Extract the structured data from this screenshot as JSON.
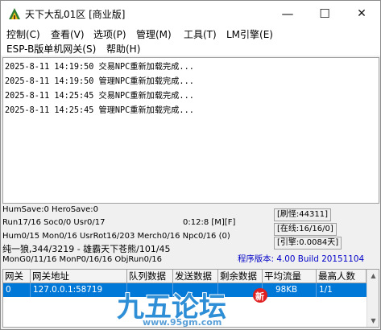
{
  "window": {
    "title": "天下大乱01区 [商业版]"
  },
  "menus": [
    "控制(C)",
    "查看(V)",
    "选项(P)",
    "管理(M)",
    "工具(T)",
    "LM引擎(E)",
    "ESP-B版单机网关(S)",
    "帮助(H)"
  ],
  "log": [
    "2025-8-11 14:19:50 交易NPC重新加载完成...",
    "2025-8-11 14:19:50 管理NPC重新加载完成...",
    "2025-8-11 14:25:45 交易NPC重新加载完成...",
    "2025-8-11 14:25:45 管理NPC重新加载完成..."
  ],
  "status": {
    "line1": "HumSave:0 HeroSave:0",
    "line2": "Run17/16 Soc0/0 Usr0/17",
    "line3": "Hum0/15 Mon0/16 UsrRot16/203 Merch0/16 Npc0/16 (0)",
    "line4": "纯一狼,344/3219 - 雄霸天下苍熊/101/45",
    "line5": "MonG0/11/16 MonP0/16/16 ObjRun0/16",
    "timer": "0:12:8 [M][F]",
    "refresh": "[刷怪:44311]",
    "online": "[在线:16/16/0]",
    "engine": "[引擎:0.0084天]",
    "version": "程序版本: 4.00 Build 20151104"
  },
  "table": {
    "columns": [
      "网关",
      "网关地址",
      "队列数据",
      "发送数据",
      "剩余数据",
      "平均流量",
      "最高人数"
    ],
    "rows": [
      [
        "0",
        "127.0.0.1:58719",
        "",
        "",
        "",
        "98KB",
        "1/1"
      ]
    ]
  },
  "watermark": {
    "logo": "九五论坛",
    "badge": "新",
    "url": "www.95gm.com"
  },
  "colors": {
    "selection": "#0078d7",
    "version_text": "#0000c8",
    "watermark": "#2e8fd6"
  },
  "icons": {
    "app": "game-app-icon",
    "minimize": "minimize-icon",
    "maximize": "maximize-icon",
    "close": "close-icon"
  }
}
